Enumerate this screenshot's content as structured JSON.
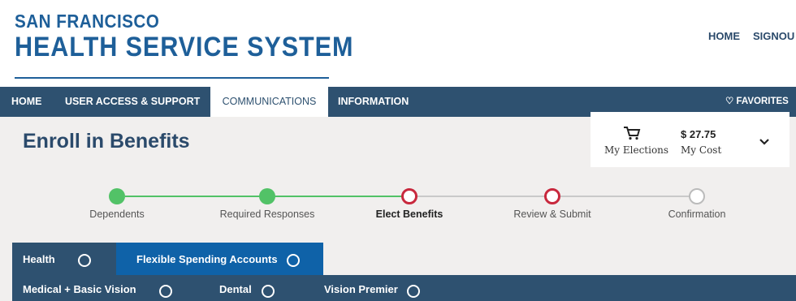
{
  "header": {
    "logo_line1": "SAN FRANCISCO",
    "logo_line2": "HEALTH SERVICE SYSTEM",
    "links": [
      "HOME",
      "SIGNOU"
    ]
  },
  "nav": {
    "items": [
      "HOME",
      "USER ACCESS & SUPPORT",
      "COMMUNICATIONS",
      "INFORMATION"
    ],
    "active": "COMMUNICATIONS",
    "favorites": "♡ FAVORITES"
  },
  "page": {
    "title": "Enroll in Benefits"
  },
  "cart": {
    "elections_label": "My Elections",
    "cost_value": "$ 27.75",
    "cost_label": "My Cost",
    "icon": "cart-icon"
  },
  "progress": {
    "steps": [
      {
        "label": "Dependents",
        "status": "done"
      },
      {
        "label": "Required Responses",
        "status": "done"
      },
      {
        "label": "Elect Benefits",
        "status": "current"
      },
      {
        "label": "Review & Submit",
        "status": "incomplete"
      },
      {
        "label": "Confirmation",
        "status": "pending"
      }
    ],
    "colors": {
      "done": "#52c267",
      "current": "#c8283d",
      "pending": "#bbbbbb"
    }
  },
  "tabs": {
    "primary": [
      "Health",
      "Flexible Spending Accounts"
    ],
    "secondary": [
      "Medical + Basic Vision",
      "Dental",
      "Vision Premier"
    ]
  },
  "colors": {
    "brand": "#1e5f99",
    "nav": "#2e5170",
    "tab_active": "#0f62a8"
  }
}
